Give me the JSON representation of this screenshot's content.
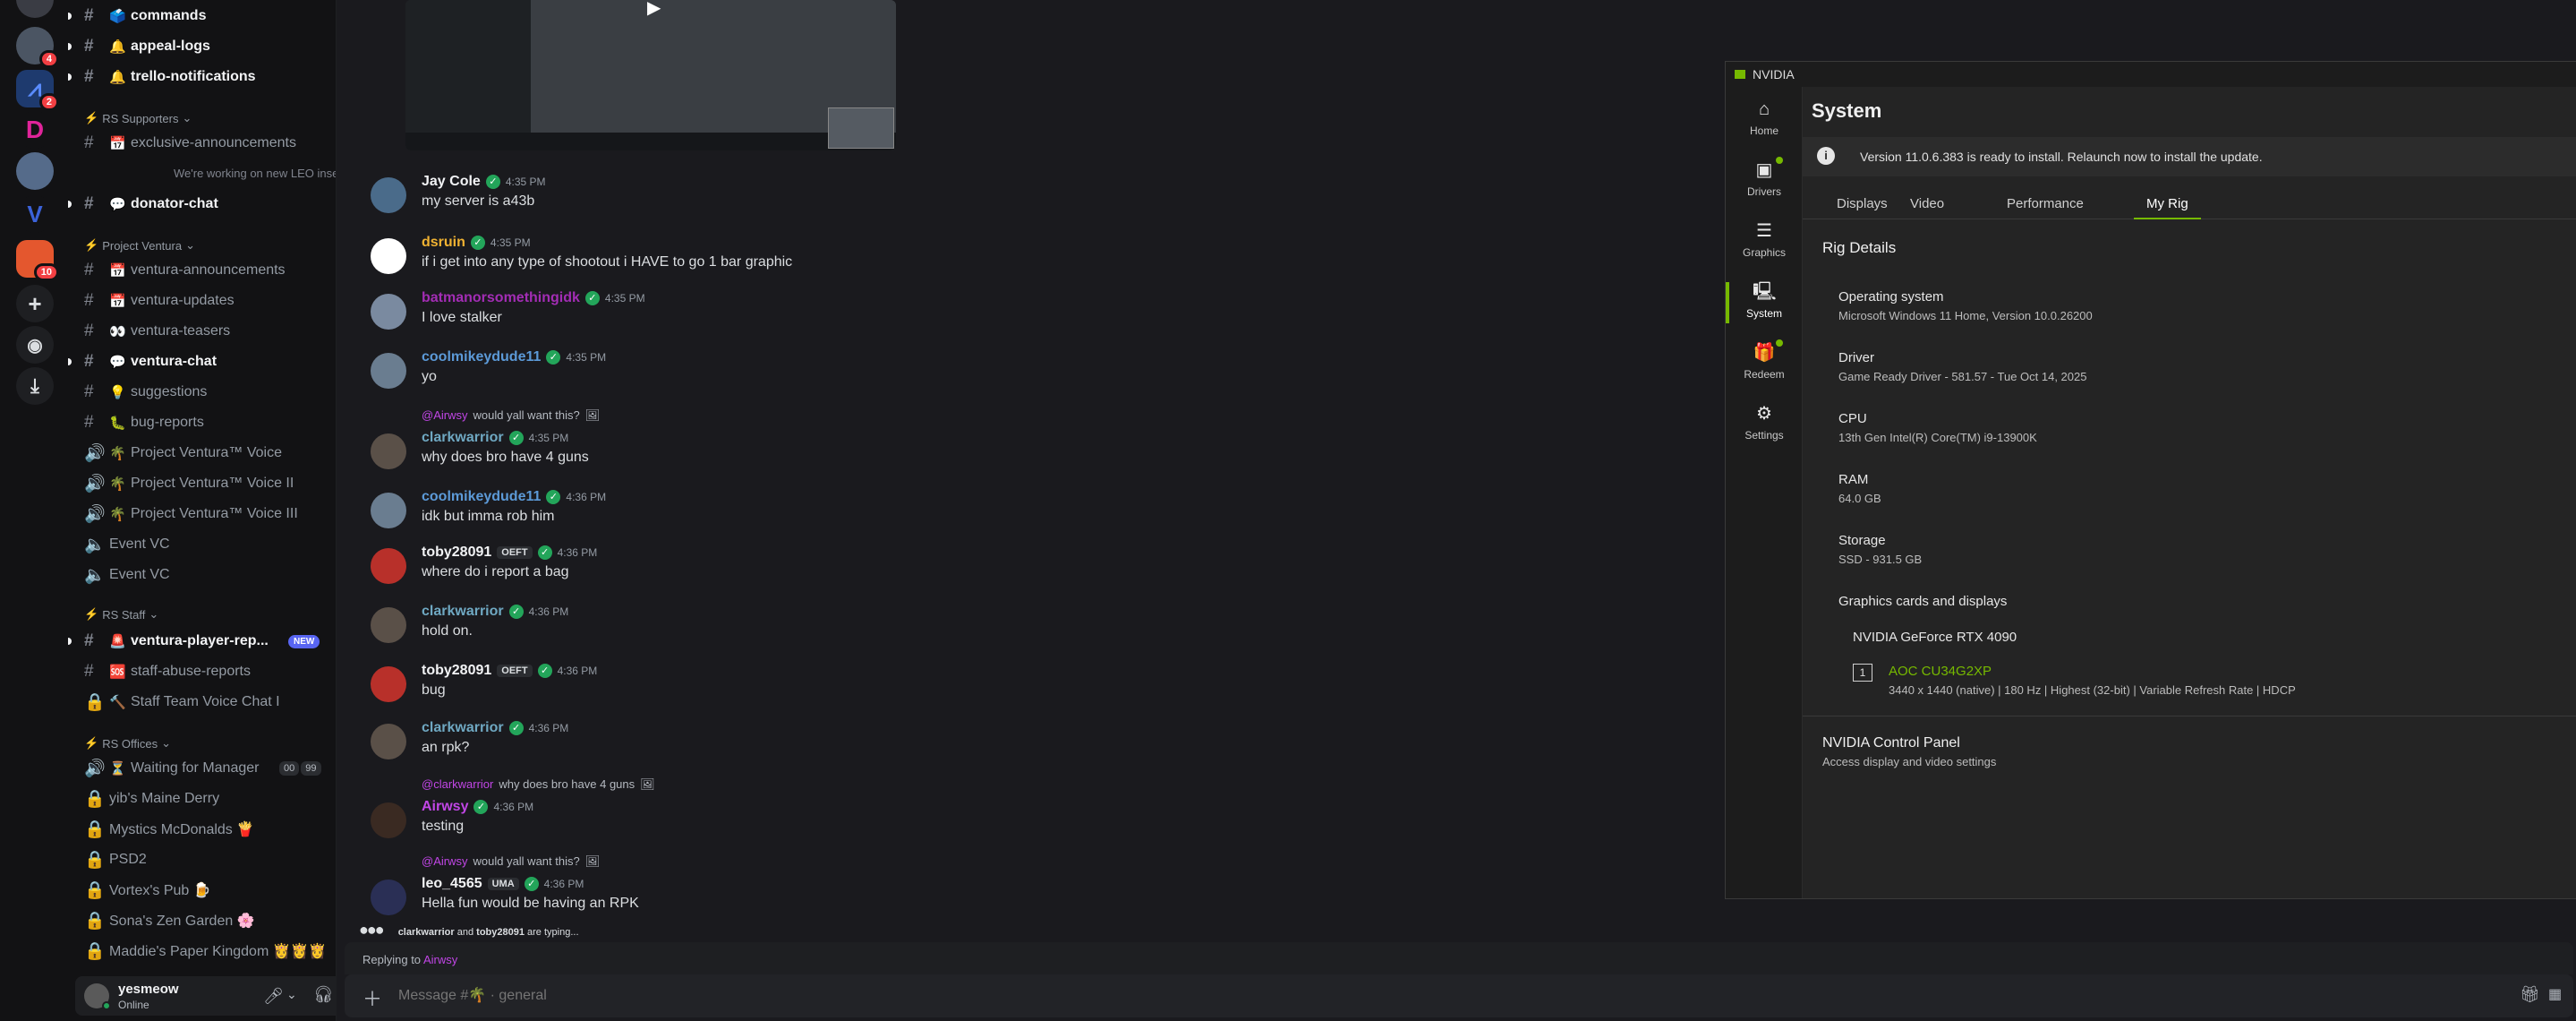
{
  "guild_rail": {
    "badges": [
      "4",
      "2",
      "10"
    ]
  },
  "channels": {
    "items": [
      {
        "label": "commands",
        "emoji": "🗳️",
        "unread": true
      },
      {
        "label": "appeal-logs",
        "emoji": "🔔",
        "unread": true
      },
      {
        "label": "trello-notifications",
        "emoji": "🔔",
        "unread": true
      }
    ],
    "cat_supporters": "RS Supporters",
    "supporters": [
      {
        "label": "exclusive-announcements",
        "emoji": "📅",
        "unread": false
      },
      {
        "label": "donator-chat",
        "emoji": "💬",
        "unread": true
      }
    ],
    "supporters_preview": "We're working on new LEO inserts and",
    "cat_ventura": "Project Ventura",
    "ventura": [
      {
        "label": "ventura-announcements",
        "emoji": "📅",
        "unread": false
      },
      {
        "label": "ventura-updates",
        "emoji": "📅",
        "unread": false
      },
      {
        "label": "ventura-teasers",
        "emoji": "👀",
        "unread": false
      },
      {
        "label": "ventura-chat",
        "emoji": "💬",
        "unread": true
      },
      {
        "label": "suggestions",
        "emoji": "💡",
        "unread": false
      },
      {
        "label": "bug-reports",
        "emoji": "🐛",
        "unread": false
      },
      {
        "label": "Project Ventura™ Voice",
        "emoji": "🌴",
        "unread": false
      },
      {
        "label": "Project Ventura™ Voice II",
        "emoji": "🌴",
        "unread": false
      },
      {
        "label": "Project Ventura™ Voice III",
        "emoji": "🌴",
        "unread": false
      },
      {
        "label": "Event VC",
        "emoji": "",
        "unread": false
      },
      {
        "label": "Event VC",
        "emoji": "",
        "unread": false
      }
    ],
    "cat_staff": "RS Staff",
    "staff": [
      {
        "label": "ventura-player-rep...",
        "emoji": "🚨",
        "unread": true,
        "badge": "NEW"
      },
      {
        "label": "staff-abuse-reports",
        "emoji": "🆘",
        "unread": false
      },
      {
        "label": "Staff Team Voice Chat I",
        "emoji": "🔨",
        "unread": false
      }
    ],
    "cat_offices": "RS Offices",
    "offices": [
      {
        "label": "Waiting for Manager",
        "emoji": "⏳",
        "unread": false,
        "counts": [
          "00",
          "99"
        ]
      },
      {
        "label": "yib's Maine Derry",
        "emoji": "",
        "unread": false
      },
      {
        "label": "Mystics McDonalds 🍟",
        "emoji": "",
        "unread": false
      },
      {
        "label": "PSD2",
        "emoji": "",
        "unread": false
      },
      {
        "label": "Vortex's Pub 🍺",
        "emoji": "",
        "unread": false
      },
      {
        "label": "Sona's Zen Garden 🌸",
        "emoji": "",
        "unread": false
      },
      {
        "label": "Maddie's Paper Kingdom 👸👸👸",
        "emoji": "",
        "unread": false
      }
    ]
  },
  "user_panel": {
    "name": "yesmeow",
    "status": "Online"
  },
  "messages": [
    {
      "user": "Jay Cole",
      "color": "#f2f3f5",
      "time": "4:35 PM",
      "text": "my server is a43b",
      "avatar": "#4a6b8a"
    },
    {
      "user": "dsruin",
      "color": "#f0b232",
      "time": "4:35 PM",
      "text": "if i get into any type of shootout i HAVE to go 1 bar graphic",
      "avatar": "#ffffff"
    },
    {
      "user": "batmanorsomethingidk",
      "color": "#a32db5",
      "time": "4:35 PM",
      "text": "I love stalker",
      "avatar": "#7a8aa0"
    },
    {
      "user": "coolmikeydude11",
      "color": "#5c9ad8",
      "time": "4:35 PM",
      "text": "yo",
      "avatar": "#6a7d90"
    },
    {
      "user": "clarkwarrior",
      "color": "#6fa8c2",
      "time": "4:35 PM",
      "text": "why does bro have 4 guns",
      "avatar": "#5a5048",
      "reply_user": "@Airwsy",
      "reply_text": "would yall want this?"
    },
    {
      "user": "coolmikeydude11",
      "color": "#5c9ad8",
      "time": "4:36 PM",
      "text": "idk but imma rob him",
      "avatar": "#6a7d90"
    },
    {
      "user": "toby28091",
      "color": "#f2f3f5",
      "time": "4:36 PM",
      "text": "where do i report a bag",
      "avatar": "#b8302a",
      "tag": "OEFT"
    },
    {
      "user": "clarkwarrior",
      "color": "#6fa8c2",
      "time": "4:36 PM",
      "text": "hold on.",
      "avatar": "#5a5048"
    },
    {
      "user": "toby28091",
      "color": "#f2f3f5",
      "time": "4:36 PM",
      "text": "bug",
      "avatar": "#b8302a",
      "tag": "OEFT"
    },
    {
      "user": "clarkwarrior",
      "color": "#6fa8c2",
      "time": "4:36 PM",
      "text": "an rpk?",
      "avatar": "#5a5048"
    },
    {
      "user": "Airwsy",
      "color": "#c146e6",
      "time": "4:36 PM",
      "text": "testing",
      "avatar": "#3a2a22",
      "reply_user": "@clarkwarrior",
      "reply_text": "why does bro have 4 guns"
    },
    {
      "user": "leo_4565",
      "color": "#f2f3f5",
      "time": "4:36 PM",
      "text": "Hella fun would be having an RPK",
      "avatar": "#2a2f55",
      "tag": "UMA",
      "reply_user": "@Airwsy",
      "reply_text": "would yall want this?"
    }
  ],
  "typing": {
    "user1": "clarkwarrior",
    "and": "and",
    "user2": "toby28091",
    "suffix": "are typing..."
  },
  "replying": {
    "label": "Replying to",
    "user": "Airwsy"
  },
  "composer": {
    "placeholder": "Message #🌴 · general"
  },
  "nvidia": {
    "app_title": "NVIDIA",
    "nav": [
      {
        "label": "Home",
        "icon": "⌂"
      },
      {
        "label": "Drivers",
        "icon": "▣"
      },
      {
        "label": "Graphics",
        "icon": "☰"
      },
      {
        "label": "System",
        "icon": "🖳"
      },
      {
        "label": "Redeem",
        "icon": "🎁"
      },
      {
        "label": "Settings",
        "icon": "⚙"
      }
    ],
    "page_title": "System",
    "banner": "Version 11.0.6.383 is ready to install. Relaunch now to install the update.",
    "tabs": [
      "Displays",
      "Video",
      "Performance",
      "My Rig"
    ],
    "active_tab": "My Rig",
    "section": "Rig Details",
    "os_label": "Operating system",
    "os_value": "Microsoft Windows 11 Home, Version 10.0.26200",
    "driver_label": "Driver",
    "driver_value": "Game Ready Driver - 581.57 - Tue Oct 14, 2025",
    "cpu_label": "CPU",
    "cpu_value": "13th Gen Intel(R) Core(TM) i9-13900K",
    "ram_label": "RAM",
    "ram_value": "64.0 GB",
    "storage_label": "Storage",
    "storage_value": "SSD - 931.5 GB",
    "gfx_label": "Graphics cards and displays",
    "gpu": "NVIDIA GeForce RTX 4090",
    "monitor_index": "1",
    "monitor": "AOC CU34G2XP",
    "monitor_spec": "3440 x 1440 (native) | 180 Hz | Highest (32-bit) | Variable Refresh Rate | HDCP",
    "cp_title": "NVIDIA Control Panel",
    "cp_desc": "Access display and video settings"
  },
  "colors": {
    "nvidia_green": "#76b900",
    "discord_blurple": "#5865f2",
    "online": "#23a55a"
  }
}
